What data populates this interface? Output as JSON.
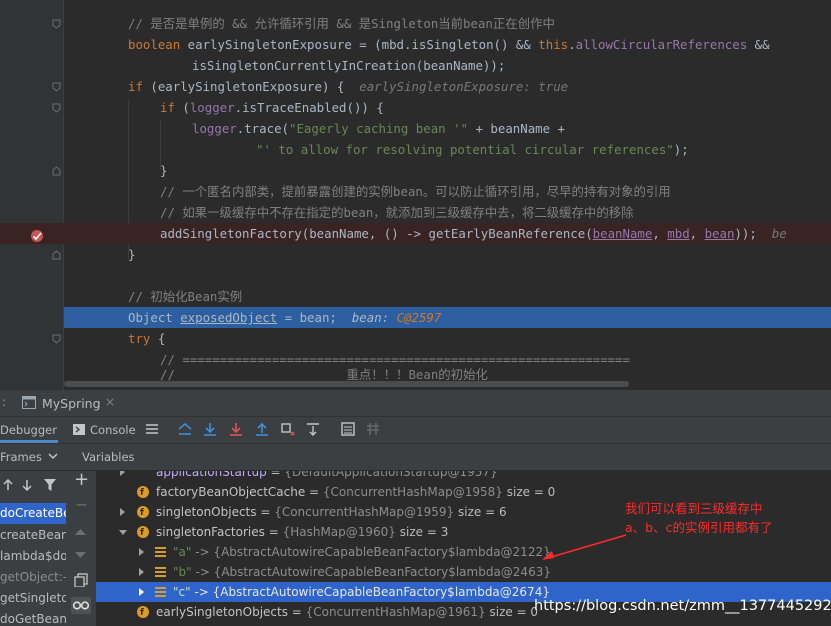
{
  "editor": {
    "lines": [
      {
        "comment": "// 是否是单例的 && 允许循环引用 && 是Singleton当前bean正在创作中"
      },
      {
        "kw": "boolean",
        "text1": " earlySingletonExposure = (mbd.isSingleton() && ",
        "kw2": "this",
        "text2": ".",
        "fld": "allowCircularReferences",
        "text3": " &&"
      },
      {
        "text": "isSingletonCurrentlyInCreation(beanName));"
      },
      {
        "kw": "if",
        "text": " (earlySingletonExposure) {",
        "hint": "earlySingletonExposure: true"
      },
      {
        "kw": "if",
        "text1": " (",
        "fld": "logger",
        "text2": ".isTraceEnabled()) {"
      },
      {
        "fld": "logger",
        "text1": ".trace(",
        "str": "\"Eagerly caching bean '\"",
        "text2": " + beanName +"
      },
      {
        "str": "\"' to allow for resolving potential circular references\"",
        "text": ");"
      },
      {
        "text": "}"
      },
      {
        "comment": "// 一个匿名内部类，提前暴露创建的实例bean。可以防止循环引用，尽早的持有对象的引用"
      },
      {
        "comment": "// 如果一级缓存中不存在指定的bean，就添加到三级缓存中去，将二级缓存中的移除"
      },
      {
        "text1": "addSingletonFactory(beanName, () -> getEarlyBeanReference(",
        "u1": "beanName",
        "c1": ", ",
        "u2": "mbd",
        "c2": ", ",
        "u3": "bean",
        "text2": "));",
        "hint": "be"
      },
      {
        "text": "}"
      },
      {
        "text": ""
      },
      {
        "comment": "// 初始化Bean实例"
      },
      {
        "text1": "Object ",
        "u": "exposedObject",
        "text2": " = bean;",
        "hint": "bean: ",
        "hintval": "C@2597"
      },
      {
        "kw": "try",
        "text": " {"
      },
      {
        "comment": "// ============================================================"
      },
      {
        "comment": "//                       重点！！！Bean的初始化"
      }
    ]
  },
  "debug": {
    "run_tab": "MySpring",
    "tabs": {
      "debugger": "Debugger",
      "console": "Console"
    },
    "frames_label": "Frames",
    "variables_label": "Variables",
    "frames": [
      "doCreateBe",
      "createBean:",
      "lambda$do",
      "getObject:-",
      "getSingleto",
      "doGetBean:"
    ],
    "variables": [
      {
        "name": "applicationStartup",
        "type": "{DefaultApplicationStartup@1957}",
        "extra": ""
      },
      {
        "name": "factoryBeanObjectCache",
        "type": "{ConcurrentHashMap@1958}",
        "extra": "size = 0"
      },
      {
        "name": "singletonObjects",
        "type": "{ConcurrentHashMap@1959}",
        "extra": "size = 6"
      },
      {
        "name": "singletonFactories",
        "type": "{HashMap@1960}",
        "extra": "size = 3"
      },
      {
        "key": "\"a\"",
        "value": "-> {AbstractAutowireCapableBeanFactory$lambda@2122}"
      },
      {
        "key": "\"b\"",
        "value": "-> {AbstractAutowireCapableBeanFactory$lambda@2463}"
      },
      {
        "key": "\"c\"",
        "value": "-> {AbstractAutowireCapableBeanFactory$lambda@2674}"
      },
      {
        "name": "earlySingletonObjects",
        "type": "{ConcurrentHashMap@1961}",
        "extra": "size = 0"
      }
    ],
    "annotation": [
      "我们可以看到三级缓存中",
      "a、b、c的实例引用都有了"
    ],
    "watermark": "https://blog.csdn.net/zmm__1377445292",
    "colors": {
      "selection": "#2f65ca",
      "exec_line": "#2d5fa0",
      "annotation": "#ff2a2a"
    }
  }
}
